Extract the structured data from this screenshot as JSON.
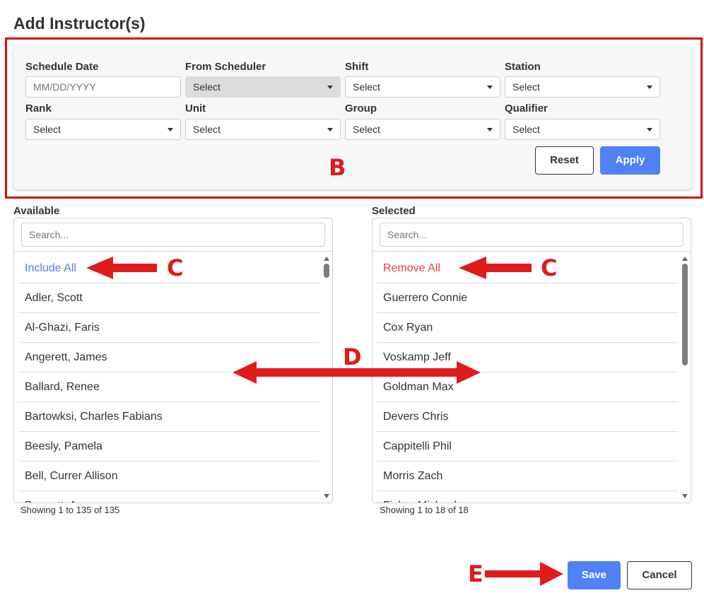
{
  "dialog": {
    "title": "Add Instructor(s)"
  },
  "filters": {
    "schedule_date": {
      "label": "Schedule Date",
      "placeholder": "MM/DD/YYYY"
    },
    "from_scheduler": {
      "label": "From Scheduler",
      "value": "Select"
    },
    "shift": {
      "label": "Shift",
      "value": "Select"
    },
    "station": {
      "label": "Station",
      "value": "Select"
    },
    "rank": {
      "label": "Rank",
      "value": "Select"
    },
    "unit": {
      "label": "Unit",
      "value": "Select"
    },
    "group": {
      "label": "Group",
      "value": "Select"
    },
    "qualifier": {
      "label": "Qualifier",
      "value": "Select"
    },
    "reset_label": "Reset",
    "apply_label": "Apply"
  },
  "available": {
    "title": "Available",
    "search_placeholder": "Search...",
    "action": "Include All",
    "items": [
      "Adler, Scott",
      "Al-Ghazi, Faris",
      "Angerett, James",
      "Ballard, Renee",
      "Bartowksi, Charles Fabians",
      "Beesly, Pamela",
      "Bell, Currer Allison",
      "Bennett, Ava"
    ],
    "showing": "Showing 1 to 135 of 135"
  },
  "selected": {
    "title": "Selected",
    "search_placeholder": "Search...",
    "action": "Remove All",
    "items": [
      "Guerrero Connie",
      "Cox Ryan",
      "Voskamp Jeff",
      "Goldman Max",
      "Devers Chris",
      "Cappitelli Phil",
      "Morris Zach",
      "Fisher Michael"
    ],
    "showing": "Showing 1 to 18 of 18"
  },
  "footer": {
    "save_label": "Save",
    "cancel_label": "Cancel"
  },
  "annotations": {
    "b": "B",
    "c": "C",
    "d": "D",
    "e": "E"
  },
  "colors": {
    "accent": "#4f82f6",
    "annotation_red": "#e01b1b",
    "include_blue": "#4a7ff0",
    "remove_red": "#e8413e"
  }
}
